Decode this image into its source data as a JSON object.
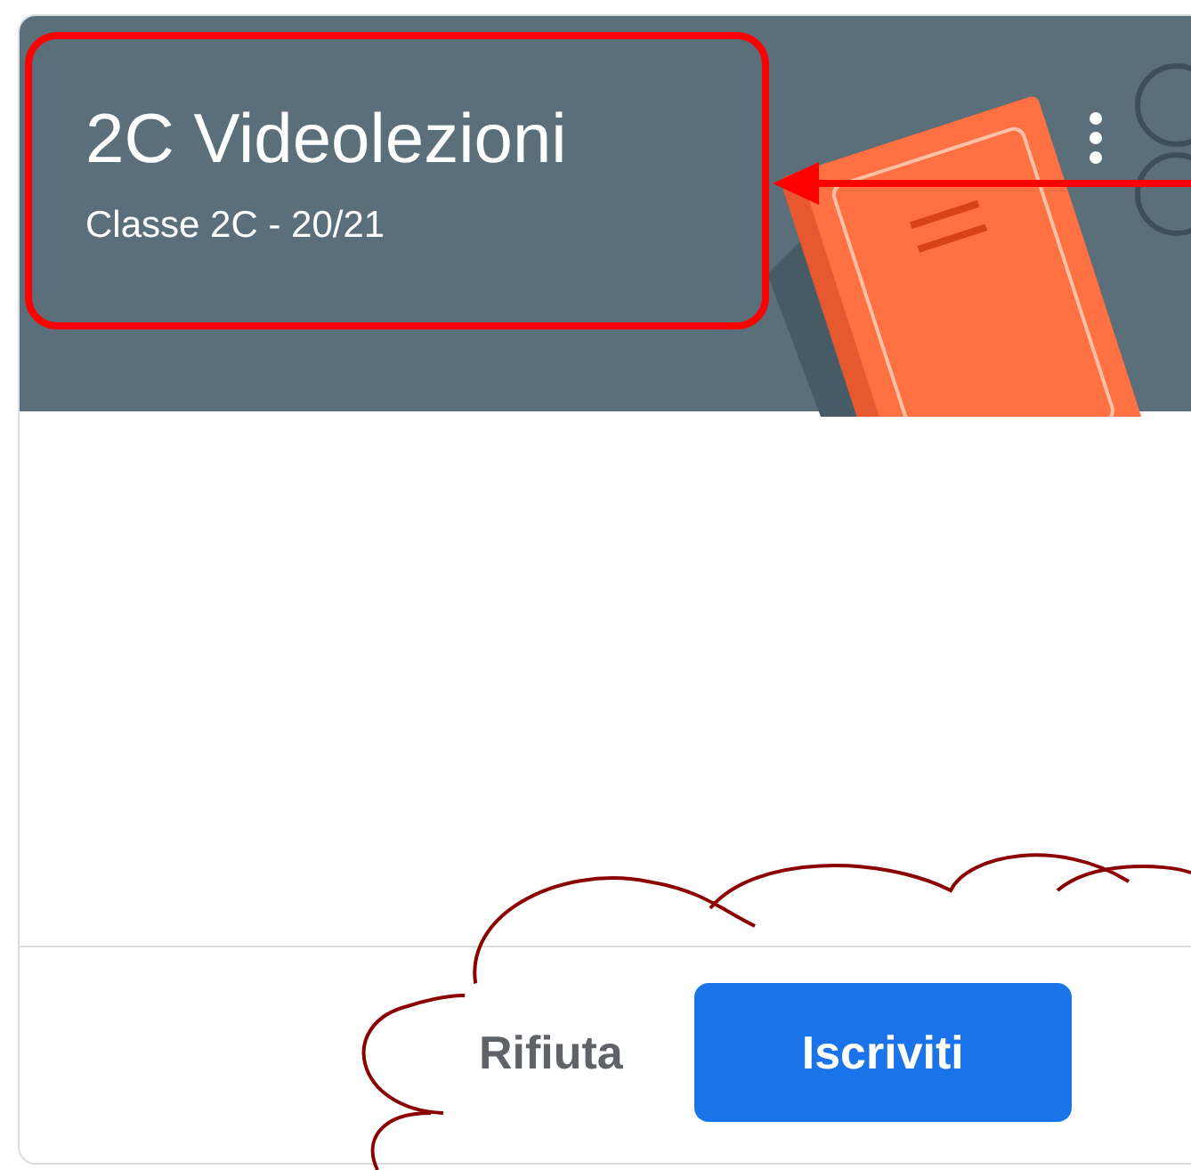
{
  "class_card": {
    "title": "2C Videolezioni",
    "subtitle": "Classe 2C - 20/21"
  },
  "actions": [
    {
      "label": "Rifiuta",
      "kind": "text"
    },
    {
      "label": "Iscriviti",
      "kind": "filled"
    }
  ]
}
